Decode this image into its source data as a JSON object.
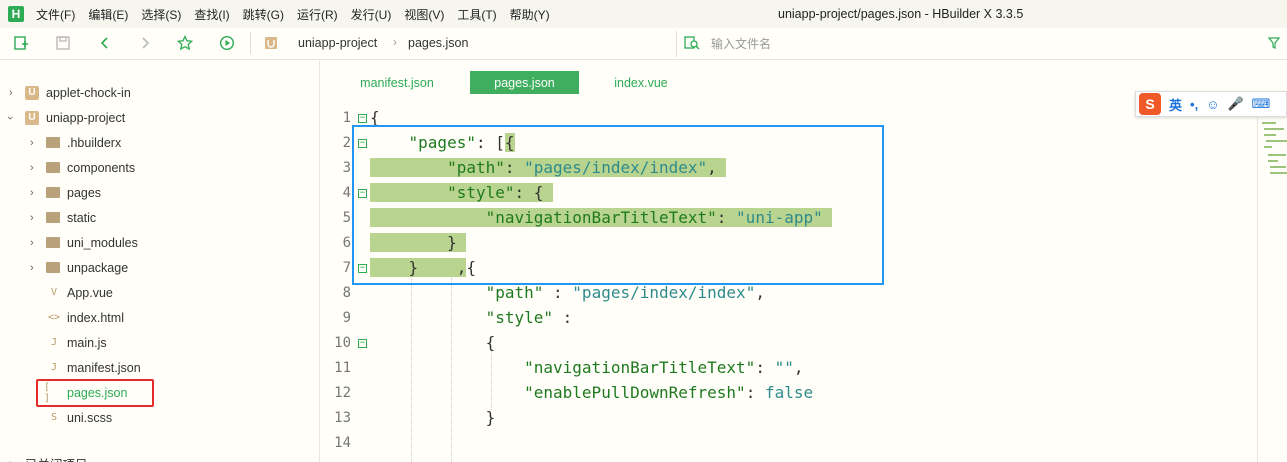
{
  "menubar": {
    "logo": "H",
    "items": [
      "文件(F)",
      "编辑(E)",
      "选择(S)",
      "查找(I)",
      "跳转(G)",
      "运行(R)",
      "发行(U)",
      "视图(V)",
      "工具(T)",
      "帮助(Y)"
    ],
    "window_title": "uniapp-project/pages.json - HBuilder X 3.3.5"
  },
  "toolbar": {
    "breadcrumb": [
      "uniapp-project",
      "pages.json"
    ],
    "search_placeholder": "输入文件名",
    "icons": [
      "new-file-icon",
      "save-icon",
      "back-icon",
      "forward-icon",
      "star-icon",
      "run-icon",
      "project-icon",
      "search-file-icon",
      "filter-icon"
    ]
  },
  "sidebar": {
    "items": [
      {
        "label": "applet-chock-in",
        "type": "project",
        "expanded": false
      },
      {
        "label": "uniapp-project",
        "type": "project",
        "expanded": true
      },
      {
        "label": ".hbuilderx",
        "type": "folder"
      },
      {
        "label": "components",
        "type": "folder"
      },
      {
        "label": "pages",
        "type": "folder"
      },
      {
        "label": "static",
        "type": "folder"
      },
      {
        "label": "uni_modules",
        "type": "folder"
      },
      {
        "label": "unpackage",
        "type": "folder"
      },
      {
        "label": "App.vue",
        "type": "file",
        "icon": "V"
      },
      {
        "label": "index.html",
        "type": "file",
        "icon": "<>"
      },
      {
        "label": "main.js",
        "type": "file",
        "icon": "J"
      },
      {
        "label": "manifest.json",
        "type": "file",
        "icon": "J"
      },
      {
        "label": "pages.json",
        "type": "file",
        "icon": "[ ]",
        "selected": true
      },
      {
        "label": "uni.scss",
        "type": "file",
        "icon": "S"
      }
    ],
    "footer": "已关闭项目"
  },
  "tabs": [
    {
      "label": "manifest.json",
      "active": false
    },
    {
      "label": "pages.json",
      "active": true
    },
    {
      "label": "index.vue",
      "active": false
    }
  ],
  "editor": {
    "line_numbers": [
      "1",
      "2",
      "3",
      "4",
      "5",
      "6",
      "7",
      "8",
      "9",
      "10",
      "11",
      "12",
      "13",
      "14"
    ]
  },
  "ime": {
    "logo": "S",
    "items": [
      "英",
      "•,",
      "☺",
      "🎤",
      "⌨"
    ]
  },
  "colors": {
    "accent": "#2dab55",
    "selection": "#b8d48e",
    "selection_frame": "#2196f3",
    "highlight_frame": "#e62b2b"
  }
}
